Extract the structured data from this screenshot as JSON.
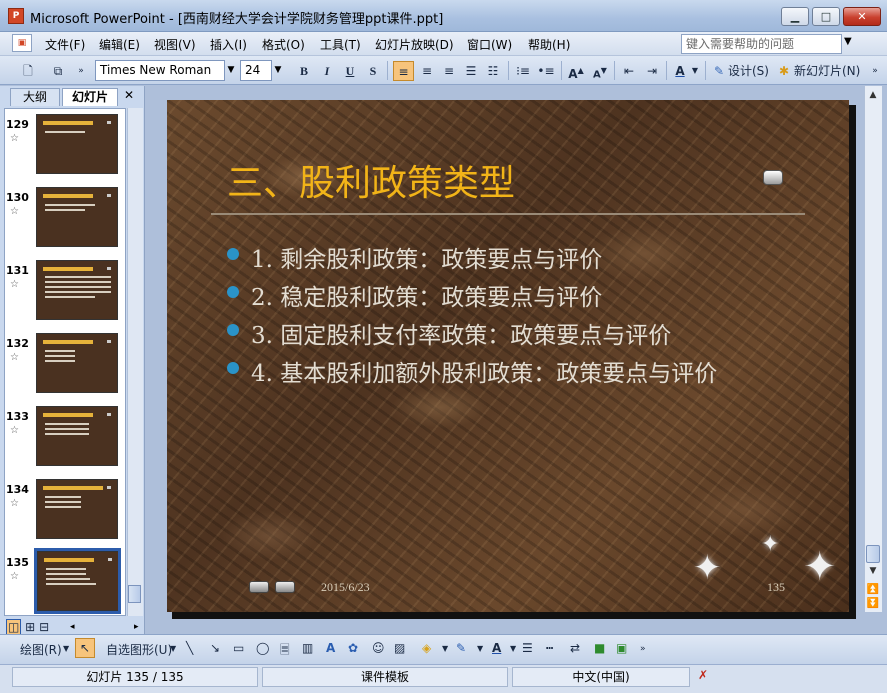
{
  "window": {
    "title": "Microsoft PowerPoint - [西南财经大学会计学院财务管理ppt课件.ppt]",
    "app_icon_label": "P"
  },
  "menu": {
    "items": [
      "文件(F)",
      "编辑(E)",
      "视图(V)",
      "插入(I)",
      "格式(O)",
      "工具(T)",
      "幻灯片放映(D)",
      "窗口(W)",
      "帮助(H)"
    ],
    "help_placeholder": "键入需要帮助的问题"
  },
  "toolbar": {
    "font_name": "Times New Roman",
    "font_size": "24",
    "bold": "B",
    "italic": "I",
    "underline": "U",
    "shadow": "S",
    "design_label": "设计(S)",
    "new_slide_label": "新幻灯片(N)"
  },
  "left_pane": {
    "tab_outline": "大纲",
    "tab_slides": "幻灯片",
    "thumbnails": [
      {
        "number": "129"
      },
      {
        "number": "130"
      },
      {
        "number": "131"
      },
      {
        "number": "132"
      },
      {
        "number": "133"
      },
      {
        "number": "134"
      },
      {
        "number": "135"
      }
    ],
    "selected_slide": "135"
  },
  "slide": {
    "title": "三、股利政策类型",
    "bullets": [
      "1. 剩余股利政策：政策要点与评价",
      "2. 稳定股利政策：政策要点与评价",
      "3. 固定股利支付率政策：政策要点与评价",
      "4. 基本股利加额外股利政策：政策要点与评价"
    ],
    "date": "2015/6/23",
    "number": "135",
    "accent_title_color": "#f2b418",
    "bullet_color": "#2a93c8"
  },
  "drawing_toolbar": {
    "draw_label": "绘图(R)",
    "autoshapes_label": "自选图形(U)"
  },
  "status": {
    "slide_position": "幻灯片 135 / 135",
    "template": "课件模板",
    "language": "中文(中国)"
  }
}
